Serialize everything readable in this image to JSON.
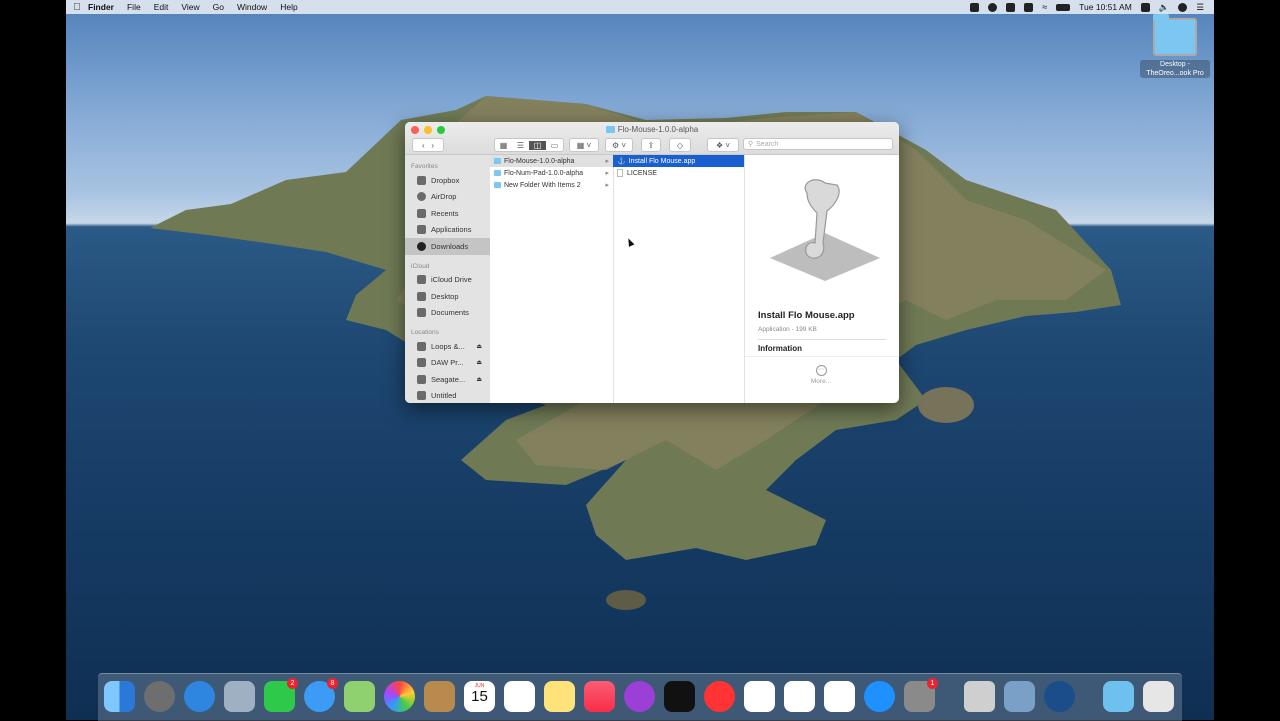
{
  "menubar": {
    "app": "Finder",
    "items": [
      "File",
      "Edit",
      "View",
      "Go",
      "Window",
      "Help"
    ],
    "clock": "Tue 10:51 AM"
  },
  "desktop": {
    "folder_label": "Desktop - TheOreo...ook Pro"
  },
  "window": {
    "title": "Flo-Mouse-1.0.0-alpha",
    "search_placeholder": "Search",
    "sidebar": {
      "favorites_header": "Favorites",
      "favorites": [
        {
          "label": "Dropbox",
          "icon": "dropbox-icon"
        },
        {
          "label": "AirDrop",
          "icon": "airdrop-icon"
        },
        {
          "label": "Recents",
          "icon": "recents-icon"
        },
        {
          "label": "Applications",
          "icon": "applications-icon"
        },
        {
          "label": "Downloads",
          "icon": "downloads-icon"
        }
      ],
      "icloud_header": "iCloud",
      "icloud": [
        {
          "label": "iCloud Drive"
        },
        {
          "label": "Desktop"
        },
        {
          "label": "Documents"
        }
      ],
      "locations_header": "Locations",
      "locations": [
        {
          "label": "Loops &..."
        },
        {
          "label": "DAW Pr..."
        },
        {
          "label": "Seagate..."
        },
        {
          "label": "Untitled"
        }
      ]
    },
    "column1": [
      {
        "label": "Flo-Mouse-1.0.0-alpha"
      },
      {
        "label": "Flo-Num-Pad-1.0.0-alpha"
      },
      {
        "label": "New Folder With Items 2"
      }
    ],
    "column2": [
      {
        "label": "Install Flo Mouse.app"
      },
      {
        "label": "LICENSE"
      }
    ],
    "preview": {
      "name": "Install Flo Mouse.app",
      "kind": "Application - 199 KB",
      "info_header": "Information",
      "more_label": "More..."
    }
  },
  "dock": {
    "badges": {
      "facetime": "2",
      "messages": "8",
      "calendar_day": "15",
      "calendar_month": "JUN",
      "prefs": "1"
    }
  }
}
